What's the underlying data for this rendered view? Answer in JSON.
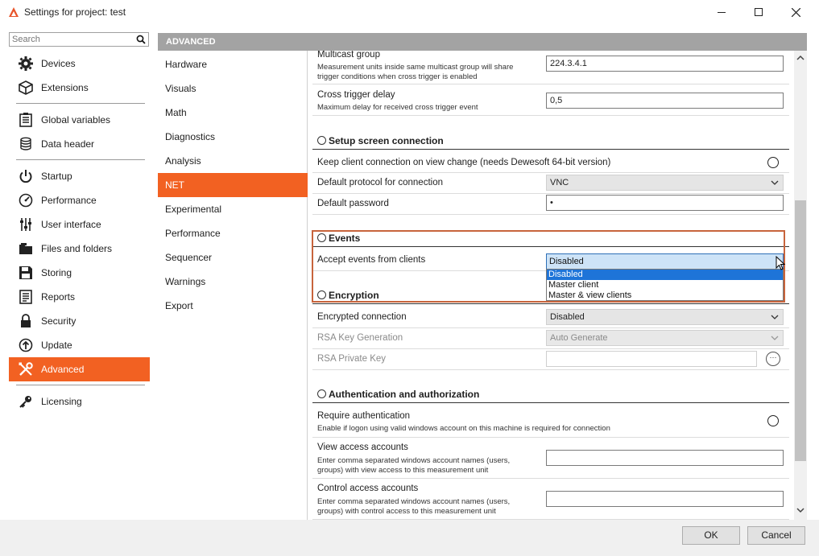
{
  "window": {
    "title": "Settings for project: test",
    "accent": "#f26122"
  },
  "search": {
    "placeholder": "Search"
  },
  "nav": {
    "items": [
      {
        "label": "Devices",
        "icon": "gear-icon"
      },
      {
        "label": "Extensions",
        "icon": "cube-icon"
      },
      {
        "label": "Global variables",
        "icon": "list-icon"
      },
      {
        "label": "Data header",
        "icon": "database-icon"
      },
      {
        "label": "Startup",
        "icon": "power-icon"
      },
      {
        "label": "Performance",
        "icon": "gauge-icon"
      },
      {
        "label": "User interface",
        "icon": "sliders-icon"
      },
      {
        "label": "Files and folders",
        "icon": "folder-icon"
      },
      {
        "label": "Storing",
        "icon": "floppy-icon"
      },
      {
        "label": "Reports",
        "icon": "report-icon"
      },
      {
        "label": "Security",
        "icon": "lock-icon"
      },
      {
        "label": "Update",
        "icon": "update-icon"
      },
      {
        "label": "Advanced",
        "icon": "tools-icon",
        "active": true
      },
      {
        "label": "Licensing",
        "icon": "key-icon"
      }
    ]
  },
  "header": {
    "title": "ADVANCED"
  },
  "subnav": {
    "items": [
      {
        "label": "Hardware"
      },
      {
        "label": "Visuals"
      },
      {
        "label": "Math"
      },
      {
        "label": "Diagnostics"
      },
      {
        "label": "Analysis"
      },
      {
        "label": "NET",
        "active": true
      },
      {
        "label": "Experimental"
      },
      {
        "label": "Performance"
      },
      {
        "label": "Sequencer"
      },
      {
        "label": "Warnings"
      },
      {
        "label": "Export"
      }
    ]
  },
  "content": {
    "multicast": {
      "label": "Multicast group",
      "desc1": "Measurement units inside same multicast group will share",
      "desc2": "trigger conditions when cross trigger is enabled",
      "value": "224.3.4.1"
    },
    "cross_trigger": {
      "label": "Cross trigger delay",
      "desc": "Maximum delay for received cross trigger event",
      "value": "0,5"
    },
    "setup_section": "Setup screen connection",
    "keep_client": {
      "label": "Keep client connection on view change (needs Dewesoft 64-bit version)",
      "checked": false
    },
    "default_protocol": {
      "label": "Default protocol for connection",
      "value": "VNC"
    },
    "default_password": {
      "label": "Default password",
      "value": "•"
    },
    "events_section": "Events",
    "accept_events": {
      "label": "Accept events from clients",
      "value": "Disabled",
      "options": [
        "Disabled",
        "Master client",
        "Master & view clients"
      ],
      "selected_index": 0
    },
    "encryption_section": "Encryption",
    "encrypted_connection": {
      "label": "Encrypted connection",
      "value": "Disabled"
    },
    "rsa_key_generation": {
      "label": "RSA Key Generation",
      "value": "Auto Generate"
    },
    "rsa_private_key": {
      "label": "RSA Private Key",
      "value": "",
      "button": "···"
    },
    "auth_section": "Authentication and authorization",
    "require_auth": {
      "label": "Require authentication",
      "desc": "Enable if logon using valid windows account on this machine is required for connection",
      "checked": false
    },
    "view_access": {
      "label": "View access accounts",
      "desc1": "Enter comma separated windows account names (users,",
      "desc2": "groups) with view access to this measurement unit",
      "value": ""
    },
    "control_access": {
      "label": "Control access accounts",
      "desc1": "Enter comma separated windows account names (users,",
      "desc2": "groups) with control access to this measurement unit",
      "value": ""
    }
  },
  "footer": {
    "ok_label": "OK",
    "cancel_label": "Cancel"
  }
}
